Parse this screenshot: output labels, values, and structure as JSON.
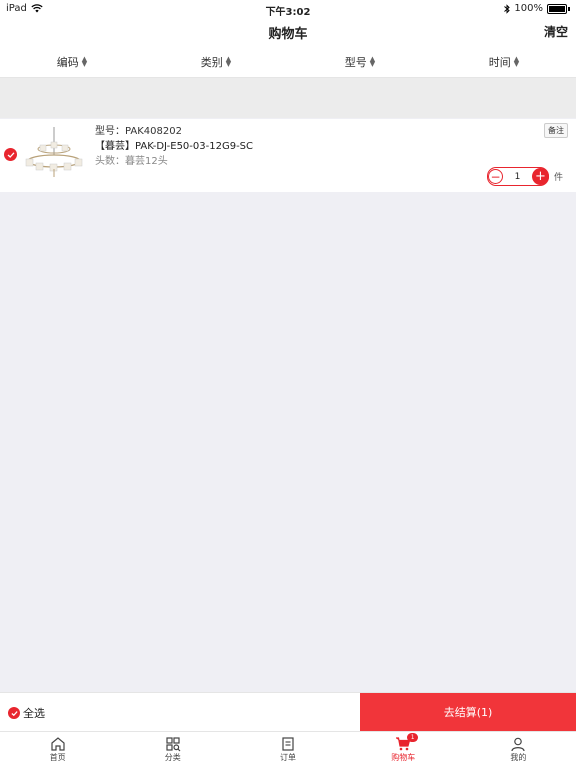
{
  "status": {
    "device": "iPad",
    "time": "下午3:02",
    "battery": "100%"
  },
  "nav": {
    "title": "购物车",
    "clear": "清空"
  },
  "sort": [
    "编码",
    "类别",
    "型号",
    "时间"
  ],
  "item": {
    "model": "型号：PAK408202",
    "name": "【暮芸】PAK-DJ-E50-03-12G9-SC",
    "heads": "头数：暮芸12头",
    "remark": "备注",
    "qty": "1",
    "unit": "件"
  },
  "bottom": {
    "select_all": "全选",
    "checkout": "去结算(1)"
  },
  "tabs": [
    {
      "label": "首页",
      "icon": "home-icon"
    },
    {
      "label": "分类",
      "icon": "category-icon"
    },
    {
      "label": "订单",
      "icon": "order-icon"
    },
    {
      "label": "购物车",
      "icon": "cart-icon",
      "badge": "1"
    },
    {
      "label": "我的",
      "icon": "profile-icon"
    }
  ],
  "colors": {
    "accent": "#e8252e",
    "checkout_bg": "#f1353a"
  }
}
